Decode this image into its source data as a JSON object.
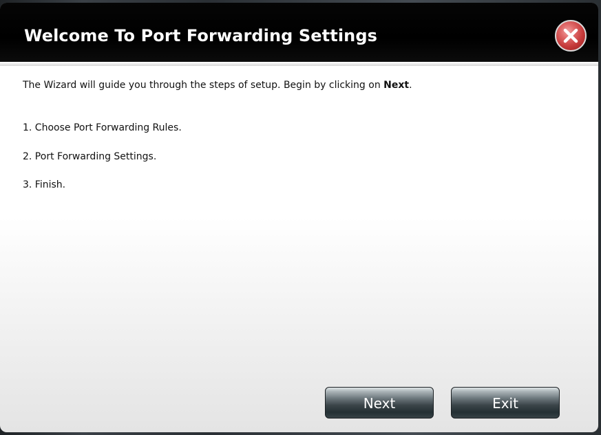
{
  "dialog": {
    "title": "Welcome To Port Forwarding Settings",
    "close_icon": "close-icon",
    "intro_prefix": "The Wizard will guide you through the steps of setup. Begin by clicking on ",
    "intro_emphasis": "Next",
    "intro_suffix": ".",
    "steps": [
      "1. Choose Port Forwarding Rules.",
      "2. Port Forwarding Settings.",
      "3. Finish."
    ],
    "buttons": {
      "next_label": "Next",
      "exit_label": "Exit"
    }
  },
  "colors": {
    "titlebar": "#000000",
    "close_button": "#c53a3a",
    "button_gradient_dark": "#243034"
  }
}
